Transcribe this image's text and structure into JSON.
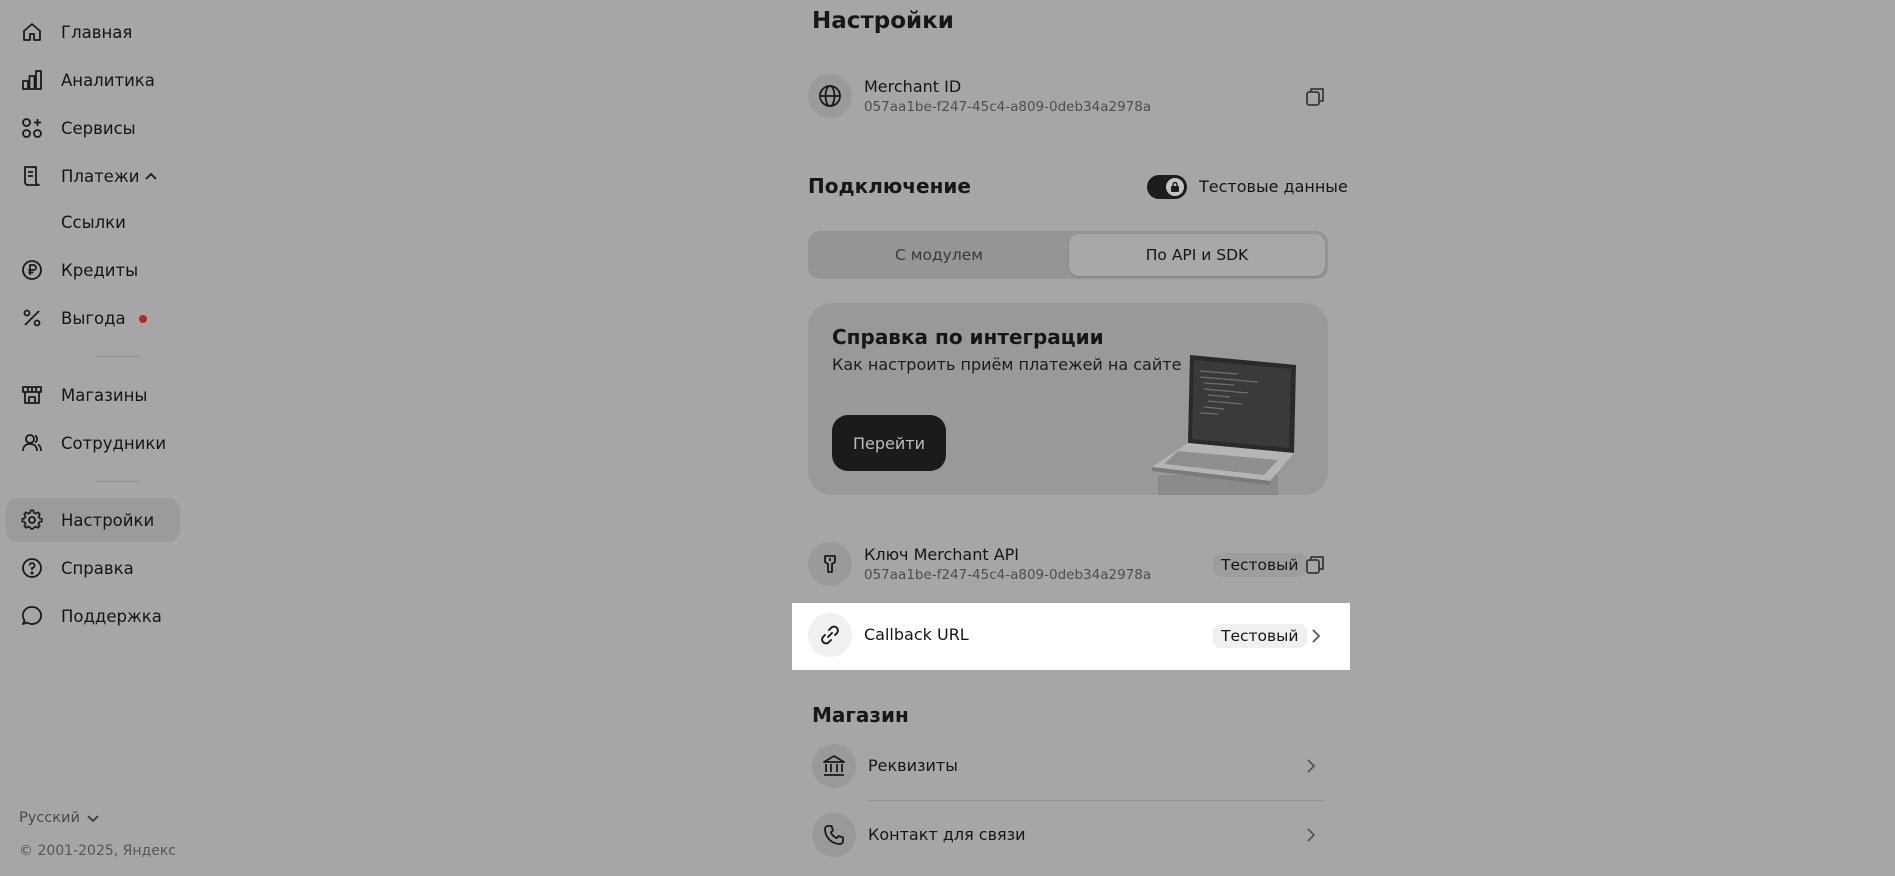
{
  "sidebar": {
    "items": [
      {
        "label": "Главная"
      },
      {
        "label": "Аналитика"
      },
      {
        "label": "Сервисы"
      },
      {
        "label": "Платежи"
      },
      {
        "label": "Ссылки"
      },
      {
        "label": "Кредиты"
      },
      {
        "label": "Выгода"
      },
      {
        "label": "Магазины"
      },
      {
        "label": "Сотрудники"
      },
      {
        "label": "Настройки"
      },
      {
        "label": "Справка"
      },
      {
        "label": "Поддержка"
      }
    ],
    "language": "Русский",
    "copyright": "© 2001-2025, Яндекс"
  },
  "main": {
    "title": "Настройки",
    "merchant": {
      "title": "Merchant ID",
      "value": "057aa1be-f247-45c4-a809-0deb34a2978a"
    },
    "connection": {
      "title": "Подключение",
      "toggle_label": "Тестовые данные",
      "toggle_on": true,
      "tabs": [
        {
          "label": "С модулем"
        },
        {
          "label": "По API и SDK"
        }
      ],
      "selected_tab": "По API и SDK"
    },
    "help_card": {
      "title": "Справка по интеграции",
      "subtitle": "Как настроить приём платежей на сайте",
      "button": "Перейти"
    },
    "api_key": {
      "title": "Ключ Merchant API",
      "value": "057aa1be-f247-45c4-a809-0deb34a2978a",
      "badge": "Тестовый"
    },
    "callback": {
      "title": "Callback URL",
      "badge": "Тестовый"
    },
    "shop": {
      "title": "Магазин",
      "items": [
        {
          "label": "Реквизиты"
        },
        {
          "label": "Контакт для связи"
        }
      ]
    }
  },
  "colors": {
    "overlay": "#a6a6a6",
    "highlight": "#ffffff",
    "accent_dot": "#c0231f",
    "button_dark": "#1b1b1b"
  }
}
